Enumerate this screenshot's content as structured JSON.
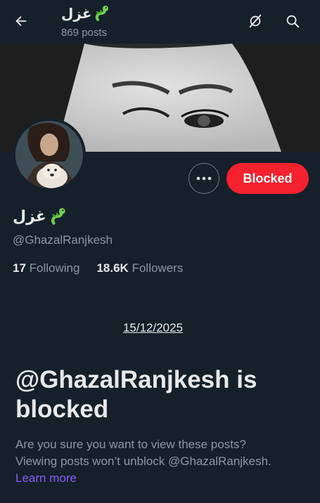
{
  "header": {
    "title": "غزل",
    "posts_count": "869 posts"
  },
  "profile": {
    "display_name": "غزل",
    "handle": "@GhazalRanjkesh",
    "following_count": "17",
    "following_label": "Following",
    "followers_count": "18.6K",
    "followers_label": "Followers"
  },
  "actions": {
    "blocked_label": "Blocked"
  },
  "blocked_notice": {
    "date": "15/12/2025",
    "headline": "@GhazalRanjkesh is blocked",
    "line1": "Are you sure you want to view these posts?",
    "line2": "Viewing posts won’t unblock @GhazalRanjkesh.",
    "learn_more": "Learn more"
  },
  "icons": {
    "back": "arrow-left-icon",
    "grok": "grok-icon",
    "search": "search-icon",
    "more": "more-horizontal-icon",
    "emoji": "dragon-emoji-icon"
  },
  "colors": {
    "background": "#15202b",
    "blocked": "#f4212e",
    "secondary_text": "#8b98a5",
    "link": "#8b5cf6"
  }
}
